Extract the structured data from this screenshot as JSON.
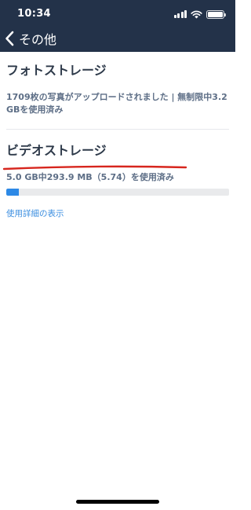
{
  "status_bar": {
    "time": "10:34"
  },
  "nav": {
    "back_label": "その他"
  },
  "photo_storage": {
    "title": "フォトストレージ",
    "description": "1709枚の写真がアップロードされました | 無制限中3.2 GBを使用済み"
  },
  "video_storage": {
    "title": "ビデオストレージ",
    "usage_text": "5.0 GB中293.9 MB（5.74）を使用済み",
    "usage_fraction": 0.0574,
    "details_link": "使用詳細の表示"
  },
  "colors": {
    "header_bg": "#233249",
    "progress_fill": "#2d89e6",
    "link": "#3d8fe0",
    "annotation_underline": "#d7261e"
  }
}
